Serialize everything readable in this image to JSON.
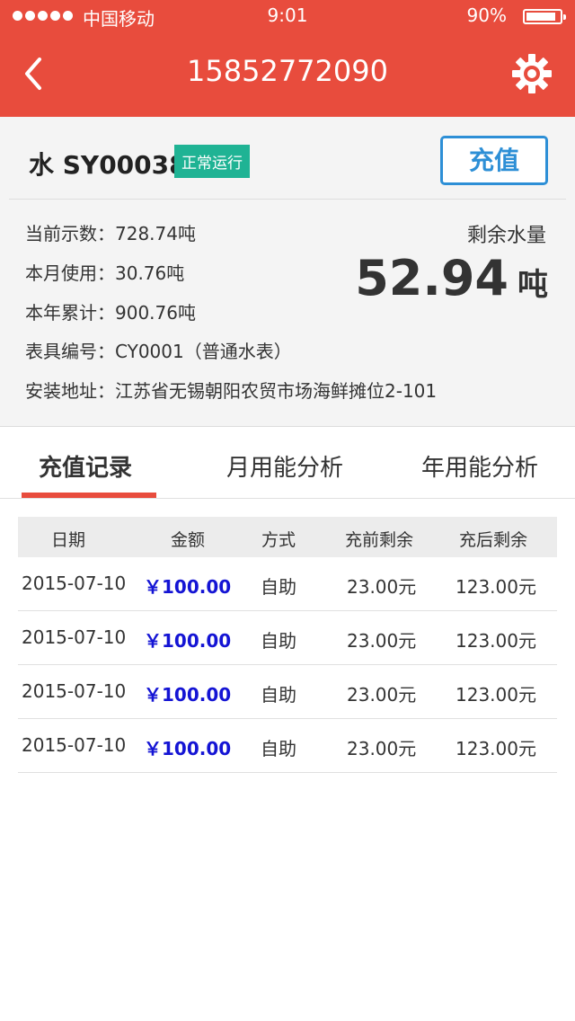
{
  "status_bar": {
    "carrier": "中国移动",
    "time": "9:01",
    "battery": "90%"
  },
  "header": {
    "title": "15852772090"
  },
  "meter": {
    "name": "水 SY00038",
    "status": "正常运行",
    "recharge_label": "充值",
    "current_reading": "当前示数：728.74吨",
    "month_usage": "本月使用：30.76吨",
    "year_total": "本年累计：900.76吨",
    "meter_no": "表具编号：CY0001（普通水表）",
    "address": "安装地址：江苏省无锡朝阳农贸市场海鲜摊位2-101",
    "remaining_label": "剩余水量",
    "remaining_value": "52.94",
    "remaining_unit": "吨"
  },
  "tabs": [
    {
      "label": "充值记录",
      "active": true
    },
    {
      "label": "月用能分析",
      "active": false
    },
    {
      "label": "年用能分析",
      "active": false
    }
  ],
  "table": {
    "headers": [
      "日期",
      "金额",
      "方式",
      "充前剩余",
      "充后剩余"
    ],
    "rows": [
      [
        "2015-07-10",
        "￥100.00",
        "自助",
        "23.00元",
        "123.00元"
      ],
      [
        "2015-07-10",
        "￥100.00",
        "自助",
        "23.00元",
        "123.00元"
      ],
      [
        "2015-07-10",
        "￥100.00",
        "自助",
        "23.00元",
        "123.00元"
      ],
      [
        "2015-07-10",
        "￥100.00",
        "自助",
        "23.00元",
        "123.00元"
      ]
    ]
  },
  "colors": {
    "brand": "#e84c3d",
    "badge": "#1fb394",
    "button": "#2d8fd6",
    "amount": "#1414d4"
  }
}
